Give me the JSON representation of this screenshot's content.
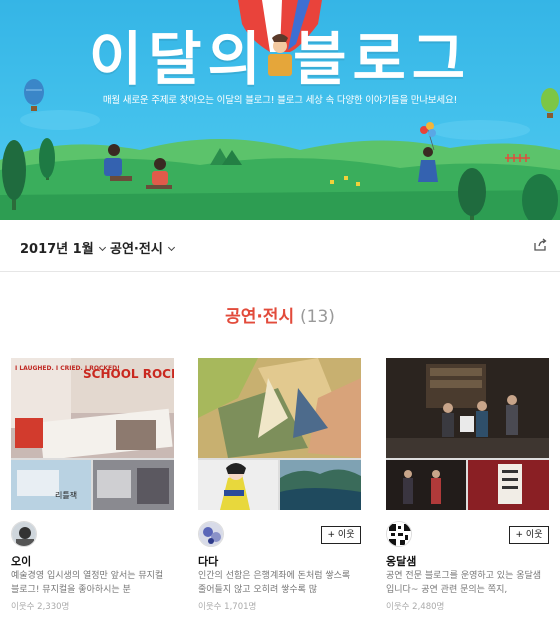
{
  "banner": {
    "title": "이달의 블로그",
    "subtitle": "매월 새로운 주제로 찾아오는 이달의 블로그! 블로그 세상 속 다양한 이야기들을 만나보세요!"
  },
  "filters": {
    "month_label": "2017년 1월",
    "category_label": "공연·전시"
  },
  "section": {
    "title": "공연·전시",
    "count": "(13)"
  },
  "cards": [
    {
      "name": "오이",
      "description": "예술경영 입시생의 열정만 앞서는 뮤지컬 블로그! 뮤지컬을 좋아하시는 분",
      "neighbors_label": "이웃수",
      "neighbors_count": "2,330명",
      "follow_label": "",
      "image_text_1": "I LAUGHED. I CRIED. I ROCKED!",
      "image_text_2": "SCHOOL ROCK",
      "image_text_3": "리틀잭"
    },
    {
      "name": "다다",
      "description": "인간의 선함은 은행계좌에 돈처럼 쌓스록 줄어들지 않고 오히려 쌓수록 많",
      "neighbors_label": "이웃수",
      "neighbors_count": "1,701명",
      "follow_label": "+ 이웃"
    },
    {
      "name": "옹달샘",
      "description": "공연 전문 블로그를 운영하고 있는 옹달샘입니다~ 공연 관련 문의는 쪽지,",
      "neighbors_label": "이웃수",
      "neighbors_count": "2,480명",
      "follow_label": "+ 이웃"
    }
  ]
}
